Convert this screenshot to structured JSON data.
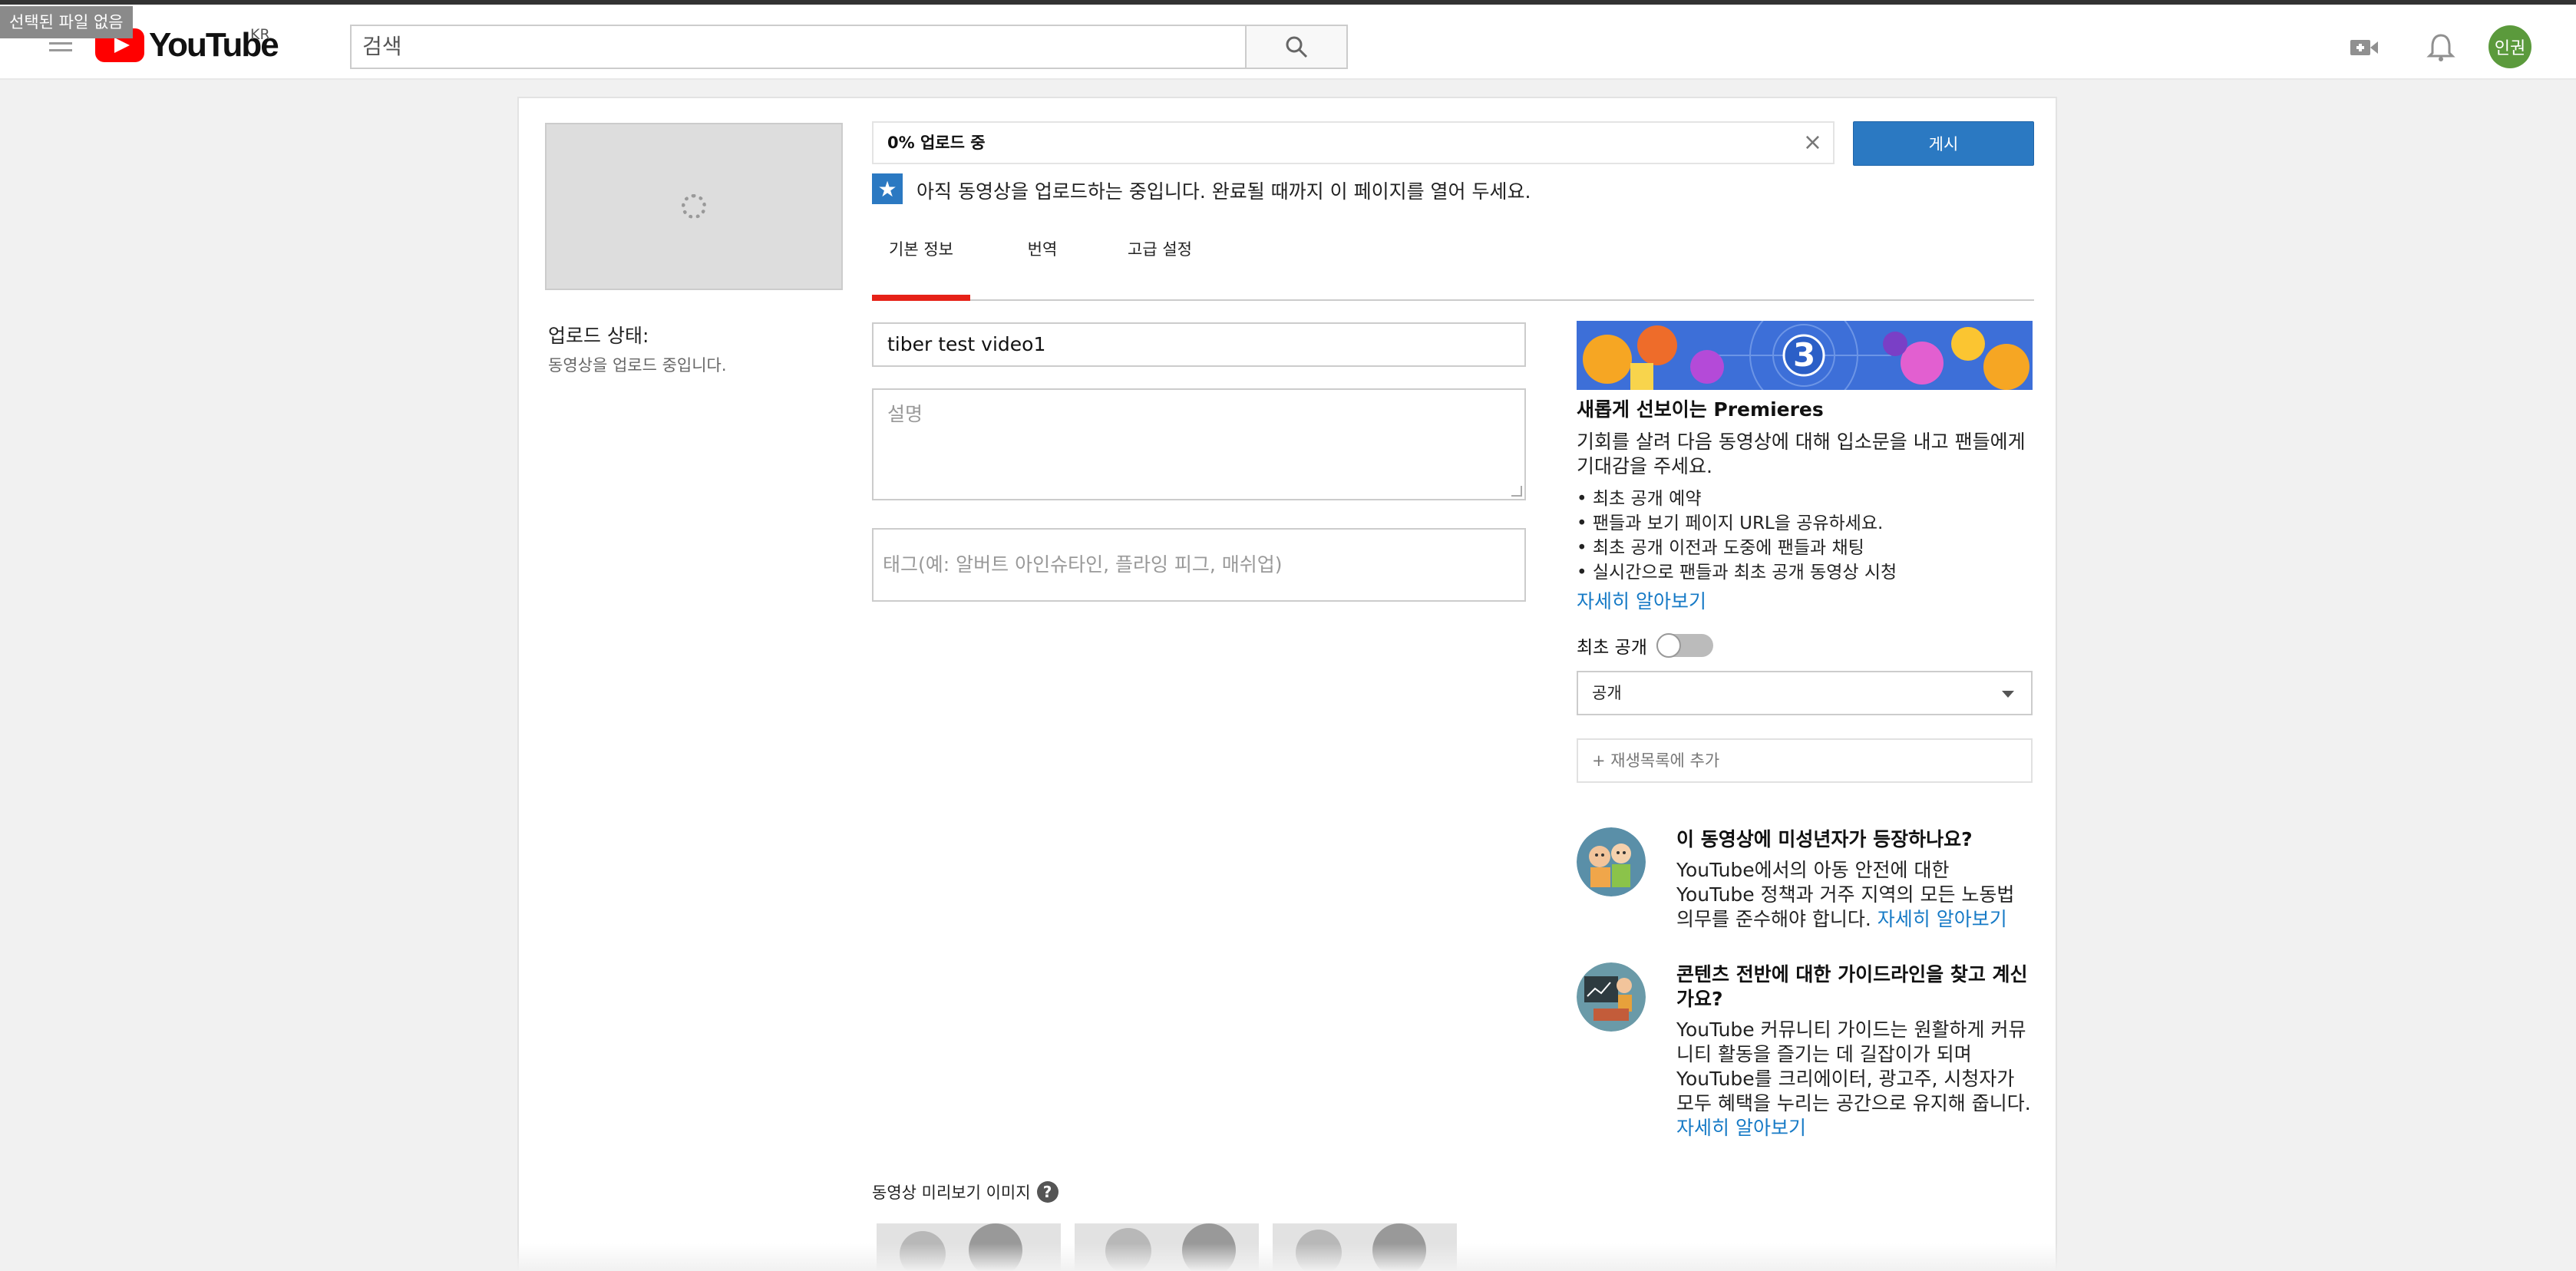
{
  "file_input_tooltip": "선택된 파일 없음",
  "header": {
    "logo_text": "YouTube",
    "country": "KR",
    "search_placeholder": "검색",
    "avatar_text": "인권",
    "icons": [
      "menu-icon",
      "search-icon",
      "video-camera-icon",
      "bell-icon"
    ]
  },
  "upload": {
    "progress_text": "0% 업로드 중",
    "publish_label": "게시",
    "notice": "아직 동영상을 업로드하는 중입니다. 완료될 때까지 이 페이지를 열어 두세요.",
    "status_title": "업로드 상태:",
    "status_text": "동영상을 업로드 중입니다."
  },
  "tabs": [
    {
      "label": "기본 정보",
      "active": true
    },
    {
      "label": "번역",
      "active": false
    },
    {
      "label": "고급 설정",
      "active": false
    }
  ],
  "form": {
    "title_value": "tiber test video1",
    "description_placeholder": "설명",
    "tags_placeholder": "태그(예: 알버트 아인슈타인, 플라잉 피그, 매쉬업)"
  },
  "premieres": {
    "banner_number": "3",
    "heading": "새롭게 선보이는 Premieres",
    "intro": "기회를 살려 다음 동영상에 대해 입소문을 내고 팬들에게 기대감을 주세요.",
    "bullets": [
      "최초 공개 예약",
      "팬들과 보기 페이지 URL을 공유하세요.",
      "최초 공개 이전과 도중에 팬들과 채팅",
      "실시간으로 팬들과 최초 공개 동영상 시청"
    ],
    "learn_more": "자세히 알아보기",
    "toggle_label": "최초 공개",
    "toggle_on": false
  },
  "privacy": {
    "selected": "공개"
  },
  "playlist_label": "+ 재생목록에 추가",
  "info": [
    {
      "heading": "이 동영상에 미성년자가 등장하나요?",
      "body": "YouTube에서의 아동 안전에 대한 YouTube 정책과 거주 지역의 모든 노동법 의무를 준수해야 합니다.",
      "link": "자세히 알아보기"
    },
    {
      "heading": "콘텐츠 전반에 대한 가이드라인을 찾고 계신가요?",
      "body": "YouTube 커뮤니티 가이드는 원활하게 커뮤니티 활동을 즐기는 데 길잡이가 되며 YouTube를 크리에이터, 광고주, 시청자가 모두 혜택을 누리는 공간으로 유지해 줍니다.",
      "link": "자세히 알아보기"
    }
  ],
  "thumbnails": {
    "label": "동영상 미리보기 이미지",
    "help_icon": "?"
  },
  "colors": {
    "accent": "#2b79c2",
    "tab_active": "#e62117",
    "link": "#167ac6",
    "avatar": "#5b9a3c"
  }
}
